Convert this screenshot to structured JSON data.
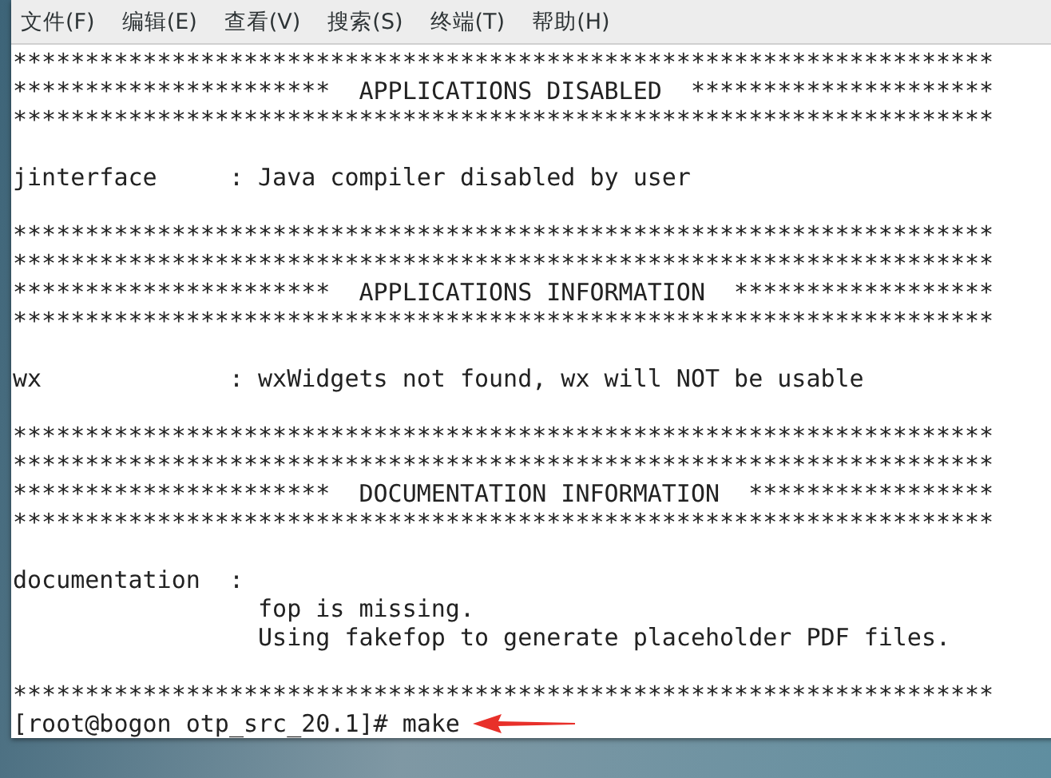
{
  "menu": [
    "文件(F)",
    "编辑(E)",
    "查看(V)",
    "搜索(S)",
    "终端(T)",
    "帮助(H)"
  ],
  "lines": [
    {
      "kind": "text",
      "text": "********************************************************************"
    },
    {
      "kind": "text",
      "text": "**********************  APPLICATIONS DISABLED  *********************"
    },
    {
      "kind": "text",
      "text": "********************************************************************"
    },
    {
      "kind": "blank"
    },
    {
      "kind": "text",
      "text": "jinterface     : Java compiler disabled by user"
    },
    {
      "kind": "blank"
    },
    {
      "kind": "text",
      "text": "********************************************************************"
    },
    {
      "kind": "text",
      "text": "********************************************************************"
    },
    {
      "kind": "text",
      "text": "**********************  APPLICATIONS INFORMATION  ******************"
    },
    {
      "kind": "text",
      "text": "********************************************************************"
    },
    {
      "kind": "blank"
    },
    {
      "kind": "text",
      "text": "wx             : wxWidgets not found, wx will NOT be usable"
    },
    {
      "kind": "blank"
    },
    {
      "kind": "text",
      "text": "********************************************************************"
    },
    {
      "kind": "text",
      "text": "********************************************************************"
    },
    {
      "kind": "text",
      "text": "**********************  DOCUMENTATION INFORMATION  *****************"
    },
    {
      "kind": "text",
      "text": "********************************************************************"
    },
    {
      "kind": "blank"
    },
    {
      "kind": "text",
      "text": "documentation  :"
    },
    {
      "kind": "text",
      "text": "                 fop is missing."
    },
    {
      "kind": "text",
      "text": "                 Using fakefop to generate placeholder PDF files."
    },
    {
      "kind": "blank"
    },
    {
      "kind": "text",
      "text": "********************************************************************"
    },
    {
      "kind": "prompt",
      "text": "[root@bogon otp_src_20.1]# make"
    }
  ]
}
